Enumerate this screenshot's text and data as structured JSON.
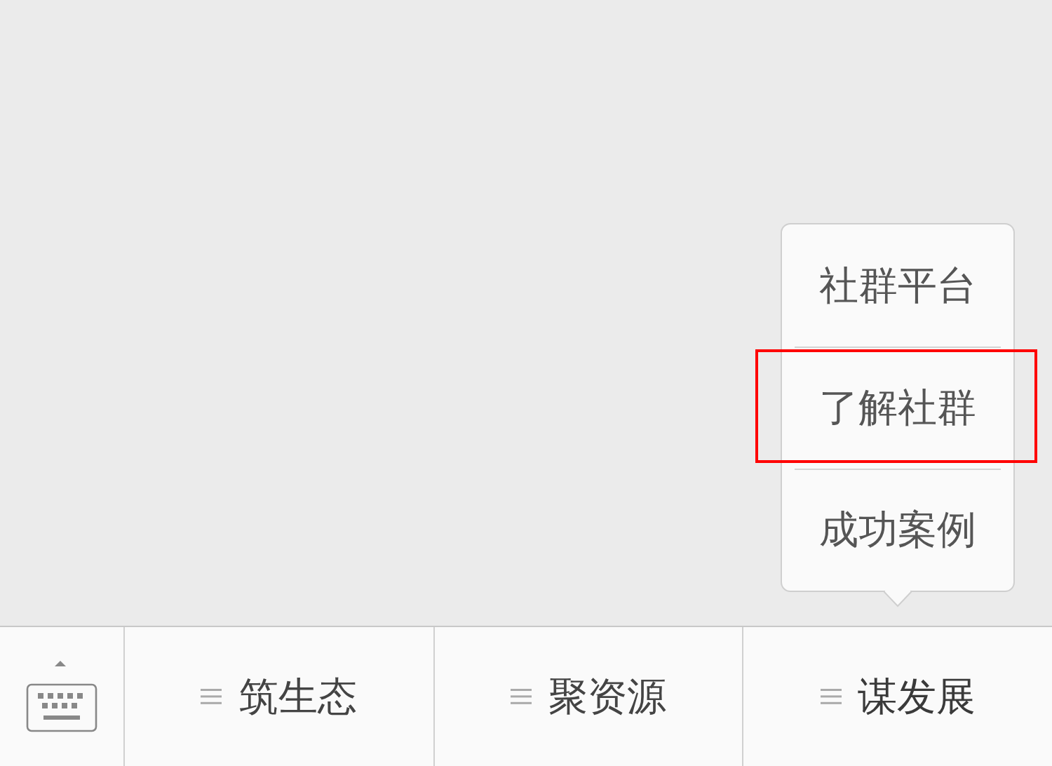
{
  "menus": [
    {
      "label": "筑生态",
      "expanded": false
    },
    {
      "label": "聚资源",
      "expanded": false
    },
    {
      "label": "谋发展",
      "expanded": true,
      "submenu": [
        {
          "label": "社群平台",
          "selected": false
        },
        {
          "label": "了解社群",
          "selected": true
        },
        {
          "label": "成功案例",
          "selected": false
        }
      ]
    }
  ]
}
